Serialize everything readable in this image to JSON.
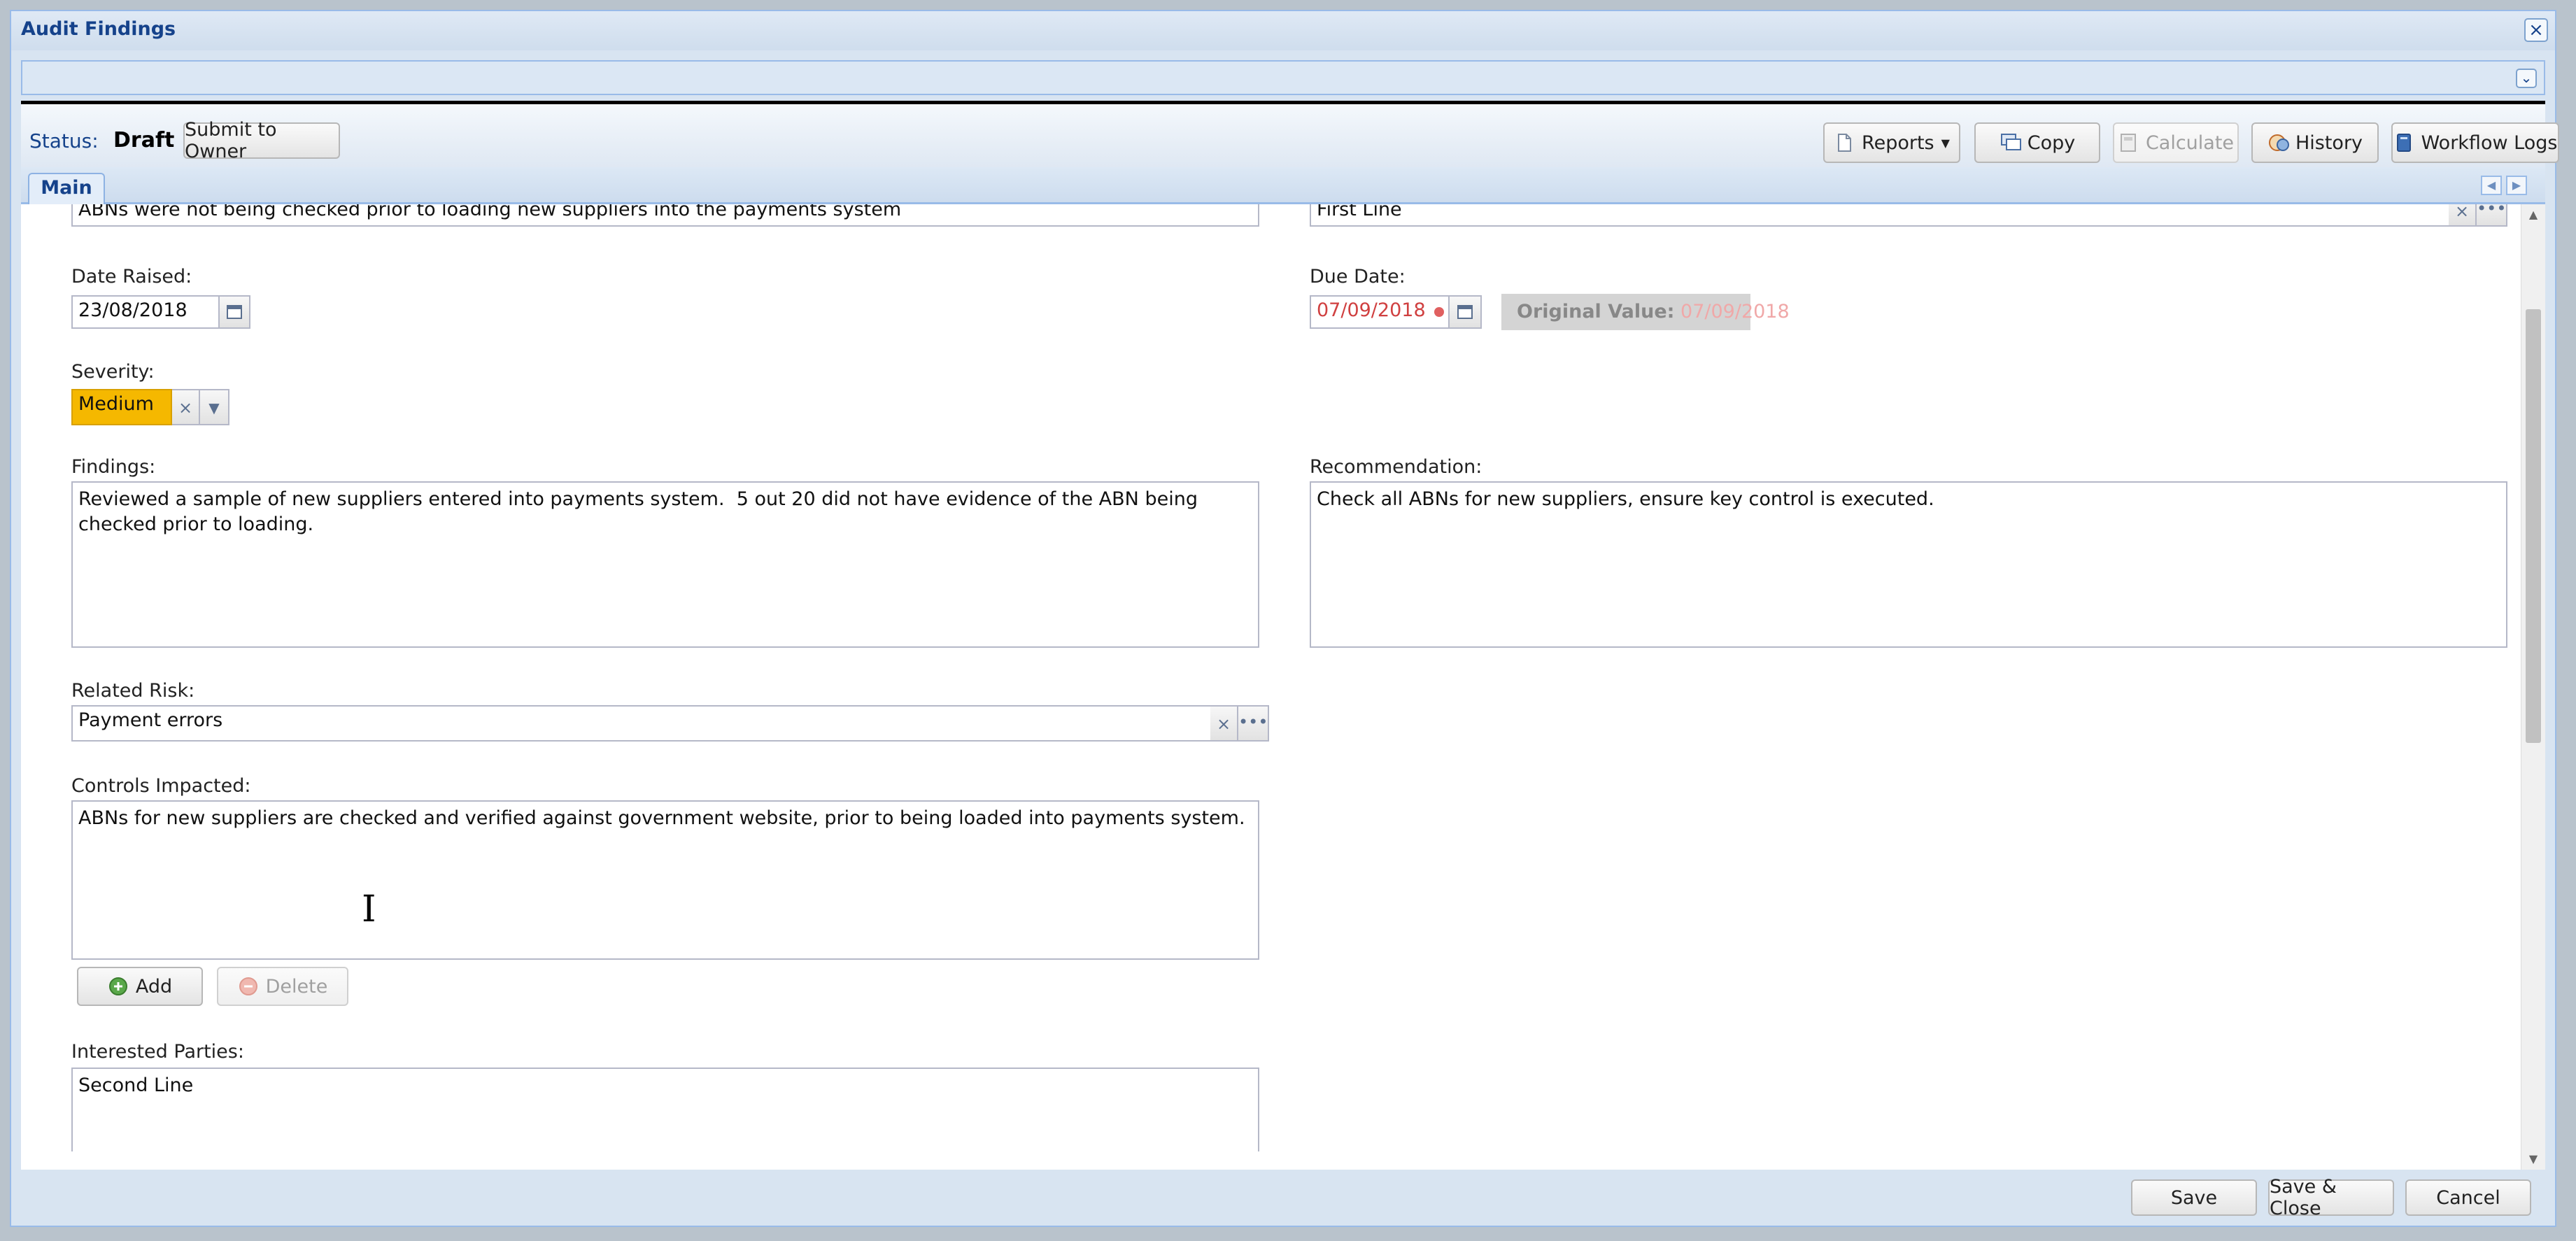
{
  "window": {
    "title": "Audit Findings"
  },
  "toolbar": {
    "status_label": "Status:",
    "status_value": "Draft",
    "submit_label": "Submit to Owner",
    "reports_label": "Reports",
    "copy_label": "Copy",
    "calculate_label": "Calculate",
    "history_label": "History",
    "workflow_logs_label": "Workflow Logs"
  },
  "tabs": [
    {
      "label": "Main"
    }
  ],
  "form": {
    "title_value": "ABNs were not being checked prior to loading new suppliers into the payments system",
    "line_value": "First Line",
    "date_raised_label": "Date Raised:",
    "date_raised_value": "23/08/2018",
    "due_date_label": "Due Date:",
    "due_date_value": "07/09/2018",
    "original_value_label": "Original Value:",
    "original_value": "07/09/2018",
    "severity_label": "Severity:",
    "severity_value": "Medium",
    "findings_label": "Findings:",
    "findings_value": "Reviewed a sample of new suppliers entered into payments system.  5 out 20 did not have evidence of the ABN being checked prior to loading.",
    "recommendation_label": "Recommendation:",
    "recommendation_value": "Check all ABNs for new suppliers, ensure key control is executed.",
    "related_risk_label": "Related Risk:",
    "related_risk_value": "Payment errors",
    "controls_label": "Controls Impacted:",
    "controls_value": "ABNs for new suppliers are checked and verified against government website, prior to being loaded into payments system.",
    "add_label": "Add",
    "delete_label": "Delete",
    "interested_parties_label": "Interested Parties:",
    "interested_parties_value": "Second Line"
  },
  "footer": {
    "save_label": "Save",
    "save_close_label": "Save & Close",
    "cancel_label": "Cancel"
  },
  "colors": {
    "severity_medium": "#f5b800",
    "accent": "#15428b",
    "due_date_text": "#d04040"
  }
}
